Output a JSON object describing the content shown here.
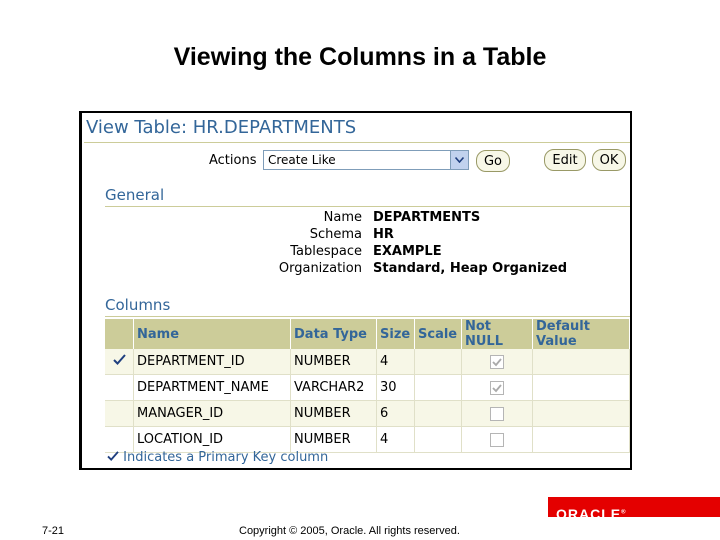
{
  "slide": {
    "title": "Viewing the Columns in a Table",
    "page_number": "7-21",
    "copyright": "Copyright © 2005, Oracle.  All rights reserved.",
    "logo_text": "ORACLE"
  },
  "page": {
    "heading": "View Table: HR.DEPARTMENTS",
    "actions_label": "Actions",
    "actions_selected": "Create Like",
    "go_label": "Go",
    "edit_label": "Edit",
    "ok_label": "OK"
  },
  "general": {
    "title": "General",
    "rows": [
      {
        "label": "Name",
        "value": "DEPARTMENTS"
      },
      {
        "label": "Schema",
        "value": "HR"
      },
      {
        "label": "Tablespace",
        "value": "EXAMPLE"
      },
      {
        "label": "Organization",
        "value": "Standard, Heap Organized"
      }
    ]
  },
  "columns": {
    "title": "Columns",
    "headers": [
      "",
      "Name",
      "Data Type",
      "Size",
      "Scale",
      "Not NULL",
      "Default Value"
    ],
    "rows": [
      {
        "pk": true,
        "name": "DEPARTMENT_ID",
        "type": "NUMBER",
        "size": "4",
        "scale": "",
        "not_null": true,
        "default": ""
      },
      {
        "pk": false,
        "name": "DEPARTMENT_NAME",
        "type": "VARCHAR2",
        "size": "30",
        "scale": "",
        "not_null": true,
        "default": ""
      },
      {
        "pk": false,
        "name": "MANAGER_ID",
        "type": "NUMBER",
        "size": "6",
        "scale": "",
        "not_null": false,
        "default": ""
      },
      {
        "pk": false,
        "name": "LOCATION_ID",
        "type": "NUMBER",
        "size": "4",
        "scale": "",
        "not_null": false,
        "default": ""
      }
    ],
    "legend": "Indicates a Primary Key column"
  },
  "colors": {
    "accent": "#336699",
    "header_bg": "#cccc99",
    "oracle_red": "#e40000"
  }
}
